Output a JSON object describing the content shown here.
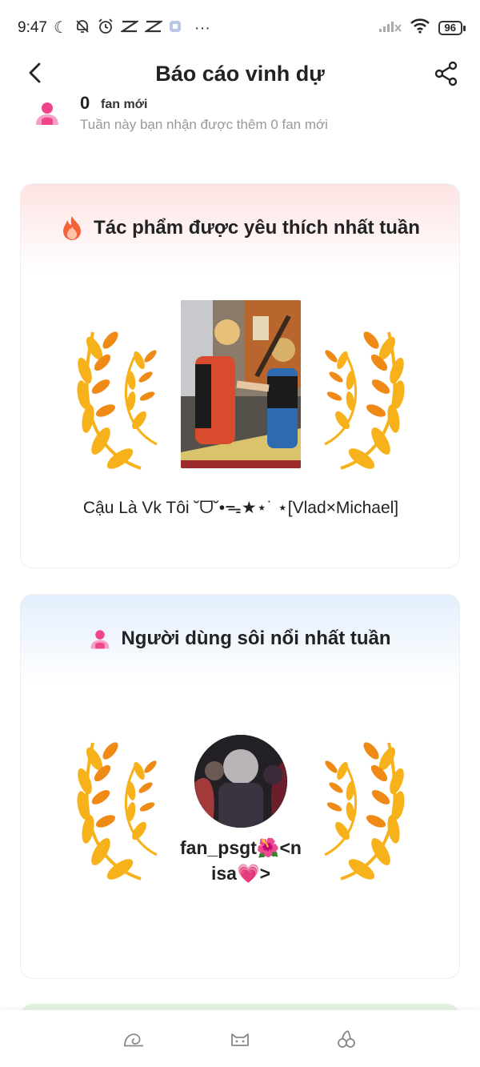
{
  "status_bar": {
    "time": "9:47",
    "battery": "96",
    "icons": [
      "moon-icon",
      "bell-off-icon",
      "alarm-icon",
      "capcut-icon",
      "capcut-icon",
      "app-icon",
      "more-dots-icon",
      "signal-icon",
      "wifi-icon",
      "battery-icon"
    ],
    "more": "···"
  },
  "header": {
    "title": "Báo cáo vinh dự",
    "back_icon": "chevron-left-icon",
    "share_icon": "share-icon"
  },
  "fans": {
    "count": "0",
    "unit": "fan mới",
    "description": "Tuần này bạn nhận được thêm 0 fan mới"
  },
  "top_work": {
    "section_title": "Tác phẩm được yêu thích nhất tuần",
    "title": "Cậu Là Vk Tôi ˘ᗜ˘•ᯓ★⋆˙ ⋆[Vlad×Michael]",
    "colors": {
      "head_gradient": "#fde3e3"
    }
  },
  "top_user": {
    "section_title": "Người dùng sôi nổi nhất tuần",
    "name_line1": "fan_psgt🌺<n",
    "name_line2": "isa💗>",
    "colors": {
      "head_gradient": "#e3eefd"
    }
  },
  "bottom_nav": {
    "items": [
      "home-icon",
      "cat-icon",
      "cherry-icon"
    ]
  },
  "colors": {
    "accent_pink": "#f0458c",
    "laurel_gold": "#f7b21b",
    "laurel_orange": "#f08a16"
  }
}
